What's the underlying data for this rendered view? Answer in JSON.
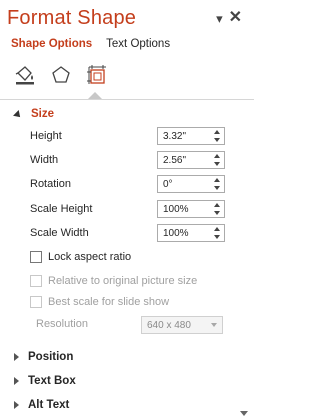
{
  "pane": {
    "title": "Format Shape",
    "header_icons": {
      "dropdown": "chevron-down-icon",
      "close": "close-icon"
    }
  },
  "tabs": [
    {
      "label": "Shape Options",
      "active": true
    },
    {
      "label": "Text Options",
      "active": false
    }
  ],
  "categories": [
    {
      "name": "fill-line-icon"
    },
    {
      "name": "effects-icon"
    },
    {
      "name": "size-properties-icon",
      "selected": true
    }
  ],
  "size_section": {
    "title": "Size",
    "expanded": true,
    "fields": [
      {
        "label": "Height",
        "value": "3.32\""
      },
      {
        "label": "Width",
        "value": "2.56\""
      },
      {
        "label": "Rotation",
        "value": "0°"
      },
      {
        "label": "Scale Height",
        "value": "100%"
      },
      {
        "label": "Scale Width",
        "value": "100%"
      }
    ],
    "checkboxes": [
      {
        "label": "Lock aspect ratio",
        "checked": false,
        "enabled": true
      },
      {
        "label": "Relative to original picture size",
        "checked": false,
        "enabled": false
      },
      {
        "label": "Best scale for slide show",
        "checked": false,
        "enabled": false
      }
    ],
    "resolution": {
      "label": "Resolution",
      "value": "640 x 480",
      "enabled": false
    }
  },
  "collapsed_sections": [
    {
      "title": "Position"
    },
    {
      "title": "Text Box"
    },
    {
      "title": "Alt Text"
    }
  ],
  "colors": {
    "accent": "#c43e1c",
    "text": "#262626",
    "disabled": "#a0a0a0"
  }
}
